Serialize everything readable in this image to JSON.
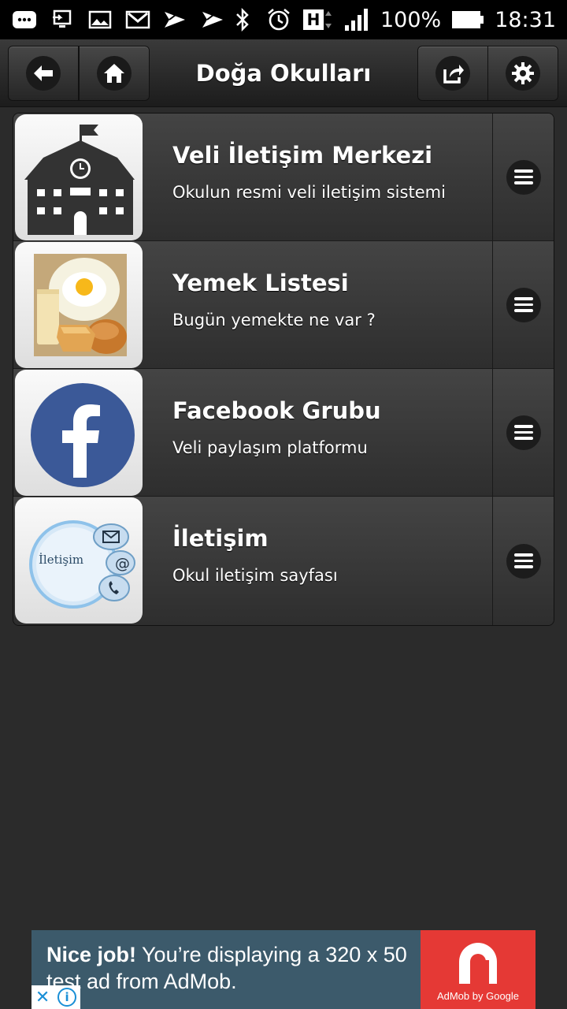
{
  "status_bar": {
    "battery_percent": "100%",
    "time": "18:31",
    "network_label": "H"
  },
  "header": {
    "title": "Doğa Okulları"
  },
  "list": {
    "items": [
      {
        "title": "Veli İletişim Merkezi",
        "subtitle": "Okulun resmi veli iletişim sistemi",
        "icon": "school-building-icon"
      },
      {
        "title": "Yemek Listesi",
        "subtitle": "Bugün yemekte ne var ?",
        "icon": "breakfast-food-icon"
      },
      {
        "title": "Facebook Grubu",
        "subtitle": "Veli paylaşım platformu",
        "icon": "facebook-icon"
      },
      {
        "title": "İletişim",
        "subtitle": "Okul iletişim sayfası",
        "icon": "contact-icon",
        "icon_text": "İletişim"
      }
    ]
  },
  "ad": {
    "bold": "Nice job!",
    "text": " You’re displaying a 320 x 50 test ad from AdMob.",
    "logo_label": "AdMob by Google"
  },
  "colors": {
    "facebook_blue": "#3b5998",
    "admob_red": "#e53935",
    "ad_background": "#3c5a6b"
  }
}
